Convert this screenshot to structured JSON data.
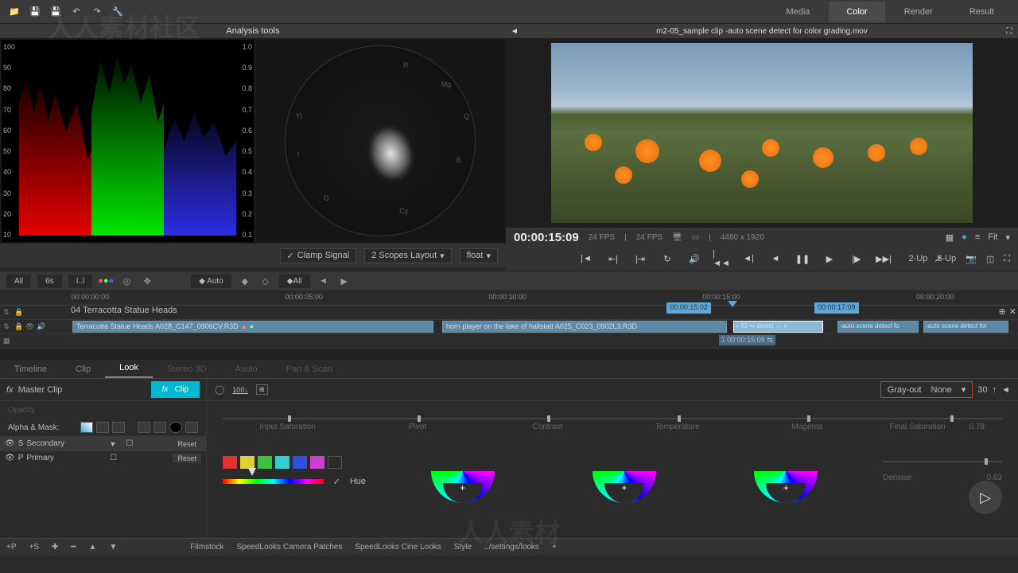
{
  "top_nav": {
    "media": "Media",
    "color": "Color",
    "render": "Render",
    "result": "Result"
  },
  "analysis": {
    "title": "Analysis tools"
  },
  "waveform": {
    "left_scale": [
      "100",
      "90",
      "80",
      "70",
      "60",
      "50",
      "40",
      "30",
      "20",
      "10"
    ],
    "right_scale": [
      "1.0",
      "0.9",
      "0.8",
      "0.7",
      "0.6",
      "0.5",
      "0.4",
      "0.3",
      "0.2",
      "0.1"
    ]
  },
  "vectorscope": {
    "labels": {
      "r": "R",
      "mg": "Mg",
      "q": "Q",
      "b": "B",
      "cy": "Cy",
      "g": "G",
      "yl": "Yl",
      "i": "I"
    }
  },
  "scope_ctrl": {
    "clamp": "Clamp Signal",
    "layout": "2 Scopes Layout",
    "mode": "float"
  },
  "viewer": {
    "title": "m2-05_sample clip -auto scene detect for color grading.mov",
    "timecode": "00:00:15:09",
    "fps1": "24 FPS",
    "fps2": "24 FPS",
    "resolution": "4480 x 1920",
    "fit": "Fit",
    "twoup": "2-Up",
    "threeup": "3-Up"
  },
  "timeline_toolbar": {
    "all": "All",
    "sixs": "6s",
    "il": "I..l",
    "auto": "Auto",
    "all2": "All"
  },
  "ruler": {
    "ticks": [
      {
        "label": "00:00:00:00",
        "pos": 7
      },
      {
        "label": "00:00:05:00",
        "pos": 28
      },
      {
        "label": "00:00:10:00",
        "pos": 48
      },
      {
        "label": "00:00:15:00",
        "pos": 69
      },
      {
        "label": "00:00:20:00",
        "pos": 90
      }
    ],
    "marker_in": "00:00:15:02",
    "marker_out": "00:00:17:09"
  },
  "tracks": {
    "name_track": "04 Terracotta Statue Heads",
    "clip1": "Terracotta Statue Heads A028_C147_0906CV.R3D",
    "clip2": "horn player on the lake of hallstatt  A025_C023_0902L3.R3D",
    "clip3": "63 ⇆ detect",
    "clip4": "-auto scene detect fo",
    "clip5": "-auto scene detect for",
    "sub_tc": "00:00:15:09",
    "sub_num": "1"
  },
  "tabs": {
    "timeline": "Timeline",
    "clip": "Clip",
    "look": "Look",
    "stereo": "Stereo 3D",
    "audio": "Audio",
    "panscan": "Pan & Scan"
  },
  "look": {
    "master_clip": "Master Clip",
    "clip": "Clip",
    "opacity": "Opacity",
    "alpha_mask": "Alpha & Mask:",
    "secondary": "Secondary",
    "s": "S",
    "primary": "Primary",
    "p": "P",
    "reset": "Reset",
    "grayout": "Gray-out",
    "none": "None",
    "thirty": "30",
    "hue": "Hue"
  },
  "params": {
    "input_sat": "Input Saturation",
    "pivot": "Pivot",
    "contrast": "Contrast",
    "temperature": "Temperature",
    "magenta": "Magenta",
    "final_sat": "Final Saturation",
    "final_sat_val": "0.78",
    "denoise": "Denoise",
    "denoise_val": "0.63"
  },
  "swatches": [
    "#e03030",
    "#e0d030",
    "#40c040",
    "#30d0d0",
    "#3050e0",
    "#d040d0"
  ],
  "bottom": {
    "add_p": "+P",
    "add_s": "+S",
    "filmstock": "Filmstock",
    "speedlooks_cam": "SpeedLooks Camera Patches",
    "speedlooks_cine": "SpeedLooks Cine Looks",
    "style": "Style",
    "settings": "../settings/looks",
    "plus": "+"
  },
  "chart_data": {
    "type": "waveform-rgb-parade",
    "y_range_left": [
      0,
      100
    ],
    "y_range_right": [
      0.0,
      1.0
    ],
    "channels": [
      "R",
      "G",
      "B"
    ],
    "note": "RGB parade waveform scope; green channel has highest peaks (~95), red mid (~85), blue lowest (~60)"
  }
}
